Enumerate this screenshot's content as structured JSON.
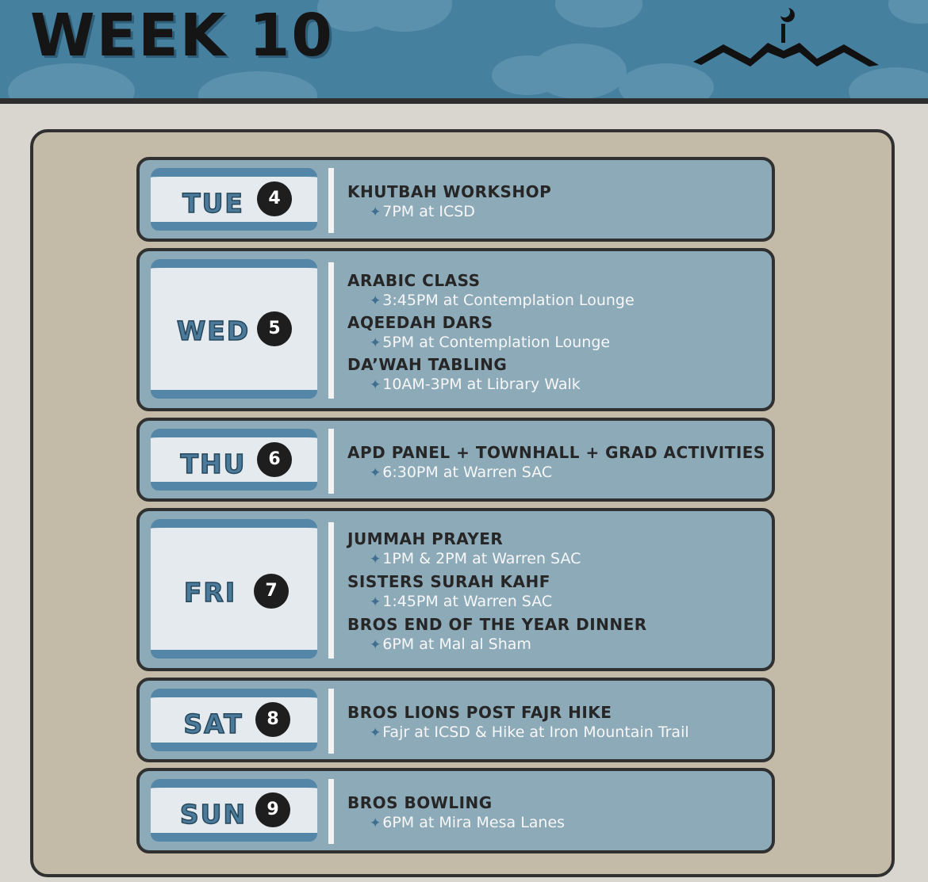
{
  "header": {
    "title": "WEEK 10",
    "logo_icon": "mosque-dome-logo-icon"
  },
  "colors": {
    "header_blue": "#46809f",
    "card_blue": "#8daab9",
    "board": "#c3bba8",
    "label_text": "#4b7a9a"
  },
  "days": [
    {
      "day": "TUE",
      "num": "4",
      "events": [
        {
          "title": "KHUTBAH WORKSHOP",
          "detail": "7PM at ICSD"
        }
      ]
    },
    {
      "day": "WED",
      "num": "5",
      "events": [
        {
          "title": "ARABIC CLASS",
          "detail": "3:45PM at Contemplation Lounge"
        },
        {
          "title": "AQEEDAH DARS",
          "detail": "5PM at Contemplation Lounge"
        },
        {
          "title": "DA’WAH TABLING",
          "detail": "10AM-3PM at Library Walk"
        }
      ]
    },
    {
      "day": "THU",
      "num": "6",
      "events": [
        {
          "title": "APD PANEL + TOWNHALL + GRAD ACTIVITIES",
          "detail": "6:30PM at Warren SAC"
        }
      ]
    },
    {
      "day": "FRI",
      "num": "7",
      "events": [
        {
          "title": "JUMMAH PRAYER",
          "detail": "1PM & 2PM at Warren SAC"
        },
        {
          "title": "SISTERS SURAH KAHF",
          "detail": "1:45PM at Warren SAC"
        },
        {
          "title": "BROS END OF THE YEAR DINNER",
          "detail": "6PM at Mal al Sham"
        }
      ]
    },
    {
      "day": "SAT",
      "num": "8",
      "events": [
        {
          "title": "BROS LIONS POST FAJR HIKE",
          "detail": "Fajr at ICSD & Hike at Iron Mountain Trail"
        }
      ]
    },
    {
      "day": "SUN",
      "num": "9",
      "events": [
        {
          "title": "BROS BOWLING",
          "detail": "6PM at Mira Mesa Lanes"
        }
      ]
    }
  ]
}
